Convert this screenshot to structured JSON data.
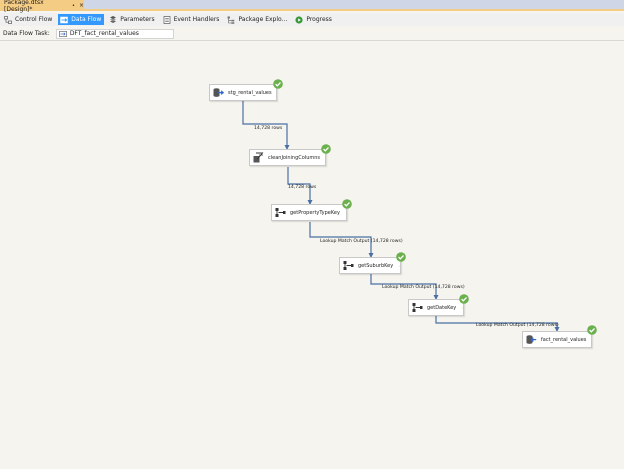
{
  "document_tab": {
    "title": "Package.dtsx [Design]*",
    "pin_glyph": "•",
    "close_glyph": "×"
  },
  "designer_tabs": [
    {
      "label": "Control Flow",
      "icon": "control-flow-icon",
      "active": false
    },
    {
      "label": "Data Flow",
      "icon": "data-flow-icon",
      "active": true
    },
    {
      "label": "Parameters",
      "icon": "parameters-icon",
      "active": false
    },
    {
      "label": "Event Handlers",
      "icon": "event-handlers-icon",
      "active": false
    },
    {
      "label": "Package Explo...",
      "icon": "package-explorer-icon",
      "active": false
    },
    {
      "label": "Progress",
      "icon": "progress-icon",
      "active": false
    }
  ],
  "task_selector": {
    "label": "Data Flow Task:",
    "value": "DFT_fact_rental_values"
  },
  "components": [
    {
      "name": "stg_rental_values",
      "icon": "ole-db-source-icon",
      "status": "success",
      "warning": false
    },
    {
      "name": "cleanJoiningColumns",
      "icon": "derived-column-icon",
      "status": "success",
      "warning": false
    },
    {
      "name": "getPropertyTypeKey",
      "icon": "lookup-icon",
      "status": "success",
      "warning": true
    },
    {
      "name": "getSuburbKey",
      "icon": "lookup-icon",
      "status": "success",
      "warning": true
    },
    {
      "name": "getDateKey",
      "icon": "lookup-icon",
      "status": "success",
      "warning": true
    },
    {
      "name": "fact_rental_values",
      "icon": "ole-db-destination-icon",
      "status": "success",
      "warning": false
    }
  ],
  "paths": [
    {
      "label": "14,728 rows"
    },
    {
      "label": "14,728 rows"
    },
    {
      "label": "Lookup Match Output (14,728 rows)"
    },
    {
      "label": "Lookup Match Output (14,728 rows)"
    },
    {
      "label": "Lookup Match Output (14,728 rows)"
    }
  ],
  "colors": {
    "canvas": "#f5f4ee",
    "active_tab": "#3399ff",
    "document_tab": "#f5cc84",
    "connector": "#4a6fa5",
    "success": "#6ab04c",
    "warning": "#f2c300"
  }
}
